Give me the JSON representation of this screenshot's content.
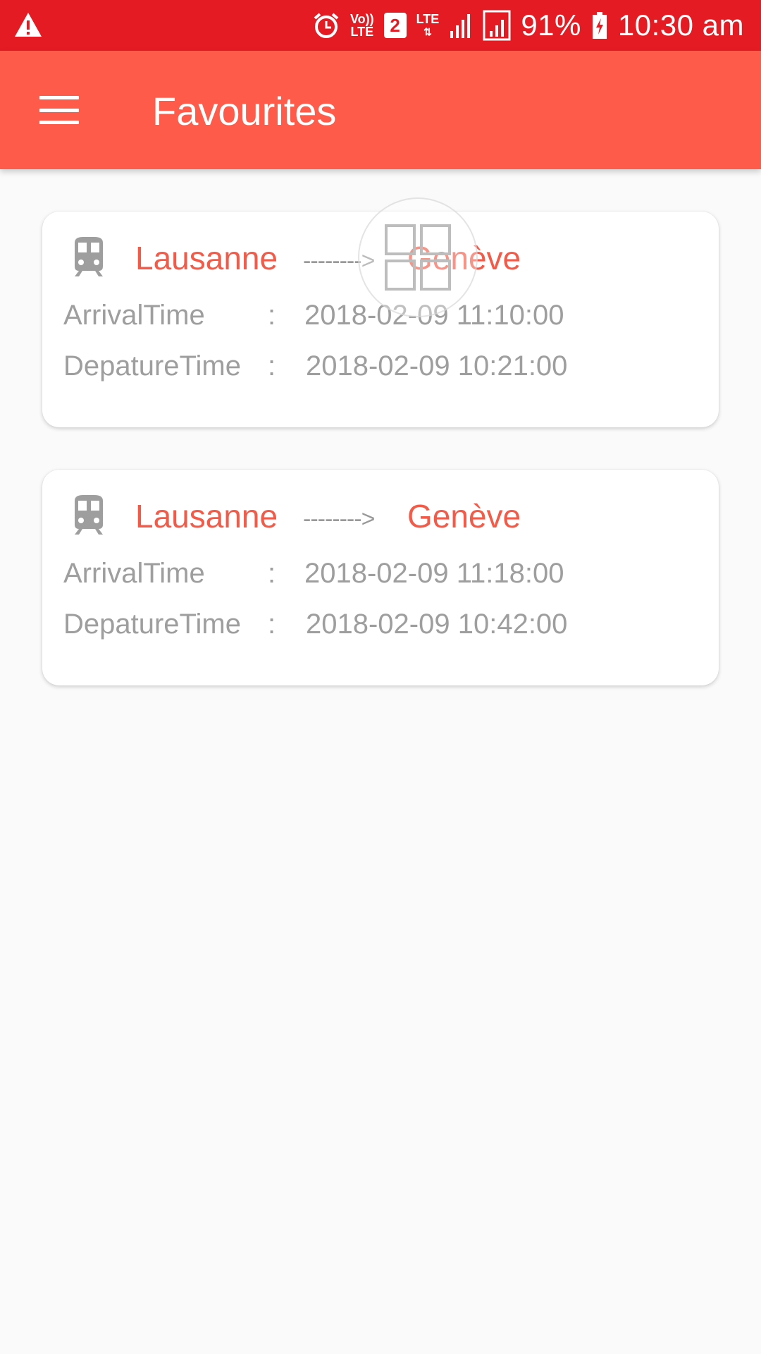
{
  "status_bar": {
    "warning_icon": "warning-icon",
    "volte_top": "Vo))",
    "volte_bottom": "LTE",
    "sim_number": "2",
    "lte_label": "LTE",
    "battery_percent": "91%",
    "time": "10:30 am",
    "background_color": "#e41b23"
  },
  "app_bar": {
    "title": "Favourites",
    "background_color": "#ff5b4a"
  },
  "favourites": [
    {
      "from": "Lausanne",
      "arrow": "-------->",
      "to": "Genève",
      "arrival_label": "ArrivalTime",
      "arrival_value": "2018-02-09 11:10:00",
      "departure_label": "DepatureTime",
      "departure_value": "2018-02-09 10:21:00",
      "colon": ":"
    },
    {
      "from": "Lausanne",
      "arrow": "-------->",
      "to": "Genève",
      "arrival_label": "ArrivalTime",
      "arrival_value": "2018-02-09 11:18:00",
      "departure_label": "DepatureTime",
      "departure_value": "2018-02-09 10:42:00",
      "colon": ":"
    }
  ],
  "accent_color": "#f45a48"
}
